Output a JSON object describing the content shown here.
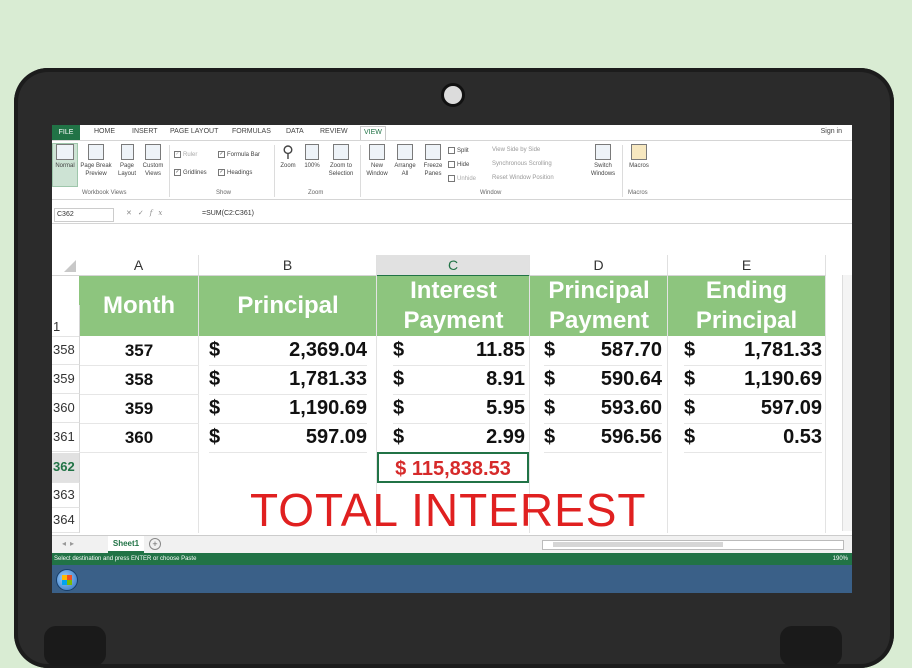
{
  "ribbon": {
    "tabs": [
      "FILE",
      "HOME",
      "INSERT",
      "PAGE LAYOUT",
      "FORMULAS",
      "DATA",
      "REVIEW",
      "VIEW"
    ],
    "active_tab": "VIEW",
    "signin": "Sign in",
    "workbook_views": {
      "normal": "Normal",
      "page_break": "Page Break Preview",
      "page_layout": "Page Layout",
      "custom": "Custom Views",
      "group": "Workbook Views"
    },
    "show": {
      "ruler": "Ruler",
      "formula_bar": "Formula Bar",
      "gridlines": "Gridlines",
      "headings": "Headings",
      "group": "Show"
    },
    "zoom": {
      "zoom": "Zoom",
      "hundred": "100%",
      "selection": "Zoom to Selection",
      "group": "Zoom"
    },
    "window": {
      "new": "New Window",
      "arrange": "Arrange All",
      "freeze": "Freeze Panes",
      "split": "Split",
      "hide": "Hide",
      "unhide": "Unhide",
      "side_by_side": "View Side by Side",
      "sync": "Synchronous Scrolling",
      "reset": "Reset Window Position",
      "switch": "Switch Windows",
      "group": "Window"
    },
    "macros": {
      "label": "Macros",
      "group": "Macros"
    }
  },
  "formula_bar": {
    "name_box": "C362",
    "formula": "=SUM(C2:C361)"
  },
  "columns": [
    "A",
    "B",
    "C",
    "D",
    "E"
  ],
  "header_row": {
    "row_num": "1",
    "month": "Month",
    "principal": "Principal",
    "interest_1": "Interest",
    "interest_2": "Payment",
    "principal_pay_1": "Principal",
    "principal_pay_2": "Payment",
    "ending_1": "Ending",
    "ending_2": "Principal"
  },
  "rows": [
    {
      "row": "358",
      "month": "357",
      "principal": "2,369.04",
      "interest": "11.85",
      "payment": "587.70",
      "ending": "1,781.33"
    },
    {
      "row": "359",
      "month": "358",
      "principal": "1,781.33",
      "interest": "8.91",
      "payment": "590.64",
      "ending": "1,190.69"
    },
    {
      "row": "360",
      "month": "359",
      "principal": "1,190.69",
      "interest": "5.95",
      "payment": "593.60",
      "ending": "597.09"
    },
    {
      "row": "361",
      "month": "360",
      "principal": "597.09",
      "interest": "2.99",
      "payment": "596.56",
      "ending": "0.53"
    }
  ],
  "currency_symbol": "$",
  "extra_rows": [
    "362",
    "363",
    "364"
  ],
  "total_value": "$ 115,838.53",
  "annotation": "TOTAL INTEREST",
  "sheet_tab": "Sheet1",
  "status_text": "Select destination and press ENTER or choose Paste",
  "zoom_level": "190%",
  "colors": {
    "excel_green": "#217346",
    "header_fill": "#8dc57e",
    "annotation_red": "#e02020"
  }
}
